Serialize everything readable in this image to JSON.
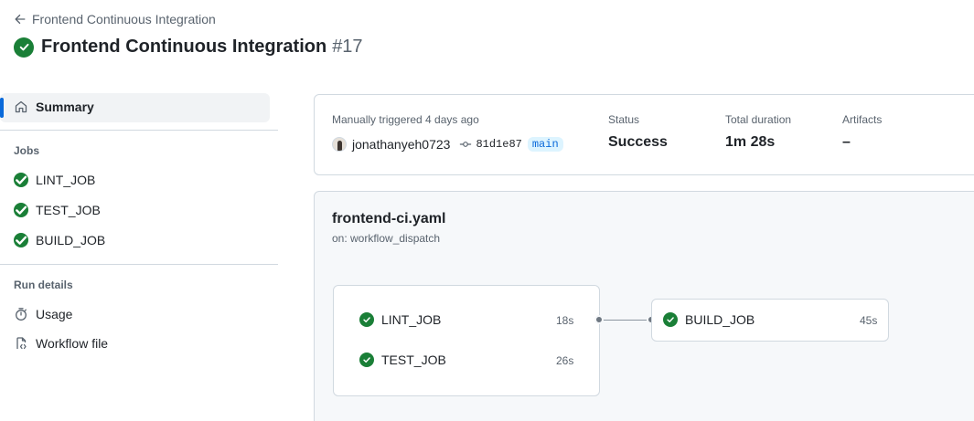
{
  "header": {
    "back_label": "Frontend Continuous Integration",
    "title": "Frontend Continuous Integration",
    "run_number": "#17"
  },
  "sidebar": {
    "summary_label": "Summary",
    "jobs_heading": "Jobs",
    "jobs": [
      {
        "label": "LINT_JOB",
        "status": "success"
      },
      {
        "label": "TEST_JOB",
        "status": "success"
      },
      {
        "label": "BUILD_JOB",
        "status": "success"
      }
    ],
    "run_details_heading": "Run details",
    "run_details": [
      {
        "label": "Usage",
        "icon": "stopwatch-icon"
      },
      {
        "label": "Workflow file",
        "icon": "workflow-file-icon"
      }
    ]
  },
  "summary": {
    "trigger_text": "Manually triggered 4 days ago",
    "user": "jonathanyeh0723",
    "commit": "81d1e87",
    "branch": "main",
    "status_label": "Status",
    "status_value": "Success",
    "duration_label": "Total duration",
    "duration_value": "1m 28s",
    "artifacts_label": "Artifacts",
    "artifacts_value": "–"
  },
  "workflow": {
    "file": "frontend-ci.yaml",
    "trigger": "on: workflow_dispatch",
    "group_jobs": [
      {
        "label": "LINT_JOB",
        "duration": "18s"
      },
      {
        "label": "TEST_JOB",
        "duration": "26s"
      }
    ],
    "downstream_job": {
      "label": "BUILD_JOB",
      "duration": "45s"
    }
  },
  "colors": {
    "success": "#1a7f37",
    "accent": "#0969da"
  }
}
